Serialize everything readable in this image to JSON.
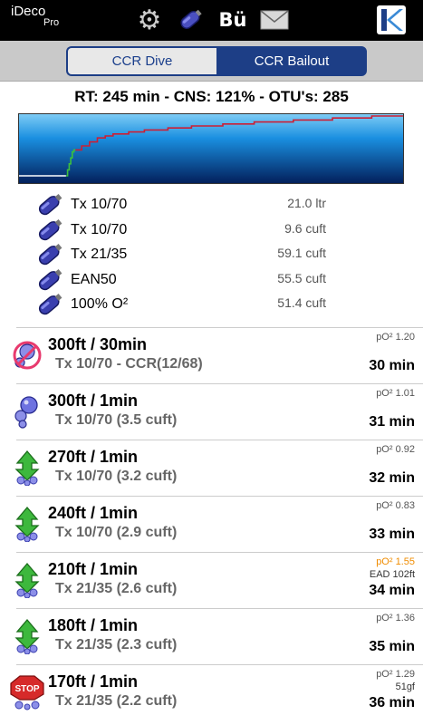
{
  "app": {
    "name": "iDeco",
    "edition": "Pro"
  },
  "toolbar": {
    "bu_label": "Bü"
  },
  "tabs": [
    {
      "label": "CCR Dive",
      "selected": false
    },
    {
      "label": "CCR Bailout",
      "selected": true
    }
  ],
  "summary": "RT: 245 min - CNS: 121% - OTU's: 285",
  "chart_data": {
    "type": "line",
    "title": "",
    "xlabel": "",
    "ylabel": "",
    "note": "dive depth profile, depth increasing downward",
    "series": [
      {
        "color": "#ffffff",
        "x": [
          0,
          30
        ],
        "y": [
          300,
          300
        ]
      },
      {
        "color": "#3cc03c",
        "x": [
          30,
          31,
          32,
          33,
          34,
          35,
          36
        ],
        "y": [
          300,
          270,
          240,
          210,
          180,
          170,
          170
        ]
      },
      {
        "color": "#cc1f35",
        "x": [
          36,
          40,
          45,
          50,
          55,
          60,
          70,
          80,
          95,
          110,
          130,
          150,
          175,
          200,
          225,
          245
        ],
        "y": [
          170,
          150,
          130,
          110,
          100,
          90,
          80,
          70,
          60,
          50,
          40,
          30,
          20,
          10,
          0,
          0
        ]
      }
    ]
  },
  "gases": [
    {
      "name": "Tx 10/70",
      "volume": "21.0 ltr"
    },
    {
      "name": "Tx 10/70",
      "volume": "9.6 cuft"
    },
    {
      "name": "Tx 21/35",
      "volume": "59.1 cuft"
    },
    {
      "name": "EAN50",
      "volume": "55.5 cuft"
    },
    {
      "name": "100% O²",
      "volume": "51.4 cuft"
    }
  ],
  "steps": [
    {
      "icon": "no-descend-icon",
      "depth": "300ft / 30min",
      "detail": "Tx 10/70 - CCR(12/68)",
      "po2": "pO² 1.20",
      "extra": "",
      "runtime": "30 min"
    },
    {
      "icon": "bubbles-icon",
      "depth": "300ft / 1min",
      "detail": "Tx 10/70 (3.5 cuft)",
      "po2": "pO² 1.01",
      "extra": "",
      "runtime": "31 min"
    },
    {
      "icon": "ascend-icon",
      "depth": "270ft / 1min",
      "detail": "Tx 10/70 (3.2 cuft)",
      "po2": "pO² 0.92",
      "extra": "",
      "runtime": "32 min"
    },
    {
      "icon": "ascend-icon",
      "depth": "240ft / 1min",
      "detail": "Tx 10/70 (2.9 cuft)",
      "po2": "pO² 0.83",
      "extra": "",
      "runtime": "33 min"
    },
    {
      "icon": "ascend-icon",
      "depth": "210ft / 1min",
      "detail": "Tx 21/35 (2.6 cuft)",
      "po2": "pO² 1.55",
      "po2_warning": true,
      "extra": "EAD 102ft",
      "runtime": "34 min"
    },
    {
      "icon": "ascend-icon",
      "depth": "180ft / 1min",
      "detail": "Tx 21/35 (2.3 cuft)",
      "po2": "pO² 1.36",
      "extra": "",
      "runtime": "35 min"
    },
    {
      "icon": "stop-icon",
      "depth": "170ft / 1min",
      "detail": "Tx 21/35 (2.2 cuft)",
      "po2": "pO² 1.29",
      "extra": "51gf",
      "runtime": "36 min",
      "stop_label": "STOP"
    }
  ],
  "colors": {
    "toolbar_bg": "#000000",
    "segment_accent": "#1d3e86",
    "warning": "#f08c00",
    "profile_red": "#cc1f35",
    "profile_green": "#3cc03c",
    "ascend_green": "#3db83d",
    "cylinder_blue": "#3a3fae"
  }
}
